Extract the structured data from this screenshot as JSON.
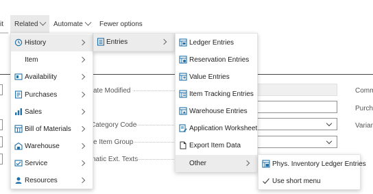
{
  "topbar": {
    "edit_fragment": "it",
    "related": "Related",
    "automate": "Automate",
    "fewer_options": "Fewer options"
  },
  "form": {
    "date_modified": "ate Modified",
    "category_code": "Category Code",
    "item_group": "e Item Group",
    "ext_texts": "natic Ext. Texts",
    "right_comm": "Comm",
    "right_purch": "Purcha",
    "right_varian": "Varian"
  },
  "related_menu": {
    "items": [
      {
        "label": "History",
        "icon": "history-icon",
        "submenu": true
      },
      {
        "label": "Item",
        "icon": "",
        "submenu": true
      },
      {
        "label": "Availability",
        "icon": "availability-icon",
        "submenu": true
      },
      {
        "label": "Purchases",
        "icon": "purchases-icon",
        "submenu": true
      },
      {
        "label": "Sales",
        "icon": "sales-icon",
        "submenu": true
      },
      {
        "label": "Bill of Materials",
        "icon": "bill-of-materials-icon",
        "submenu": true
      },
      {
        "label": "Warehouse",
        "icon": "warehouse-icon",
        "submenu": true
      },
      {
        "label": "Service",
        "icon": "service-icon",
        "submenu": true
      },
      {
        "label": "Resources",
        "icon": "resources-icon",
        "submenu": true
      }
    ]
  },
  "history_menu": {
    "items": [
      {
        "label": "Entries",
        "icon": "entries-icon",
        "submenu": true
      }
    ]
  },
  "entries_menu": {
    "items": [
      {
        "label": "Ledger Entries",
        "icon": "ledger-entries-icon"
      },
      {
        "label": "Reservation Entries",
        "icon": "reservation-entries-icon"
      },
      {
        "label": "Value Entries",
        "icon": "value-entries-icon"
      },
      {
        "label": "Item Tracking Entries",
        "icon": "item-tracking-entries-icon"
      },
      {
        "label": "Warehouse Entries",
        "icon": "warehouse-entries-icon"
      },
      {
        "label": "Application Worksheet",
        "icon": "application-worksheet-icon"
      },
      {
        "label": "Export Item Data",
        "icon": "export-item-data-icon"
      },
      {
        "label": "Other",
        "icon": "",
        "submenu": true
      }
    ]
  },
  "other_menu": {
    "items": [
      {
        "label": "Phys. Inventory Ledger Entries",
        "icon": "phys-inventory-ledger-entries-icon"
      },
      {
        "label": "Use short menu",
        "icon": "checkmark-icon"
      }
    ]
  },
  "colors": {
    "accent": "#0a7ea4",
    "icon_blue": "#1f6fa8",
    "highlight": "#ececec"
  }
}
